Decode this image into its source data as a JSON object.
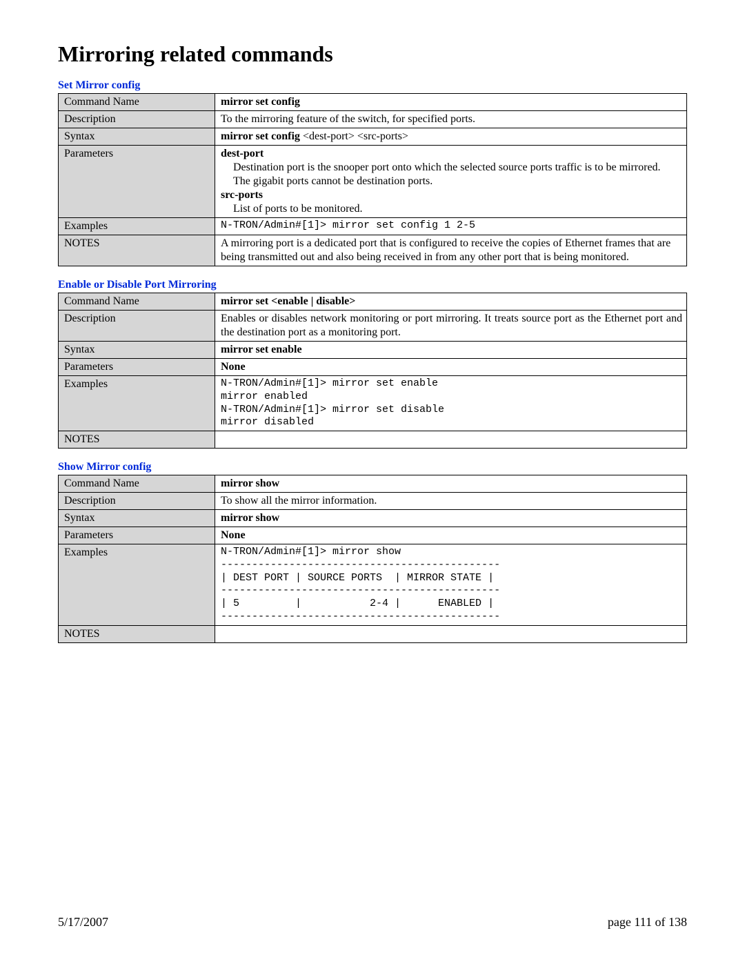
{
  "title": "Mirroring related commands",
  "sections": [
    {
      "heading": "Set Mirror config",
      "rows": {
        "command_name_label": "Command Name",
        "command_name_value": "mirror set config",
        "description_label": "Description",
        "description_value": "To the mirroring feature of the switch, for specified ports.",
        "syntax_label": "Syntax",
        "syntax_bold": "mirror set config",
        "syntax_rest": " <dest-port> <src-ports>",
        "parameters_label": "Parameters",
        "param1_name": "dest-port",
        "param1_desc1": "Destination port is the snooper port onto which the selected source ports traffic is to be mirrored.",
        "param1_desc2": "The gigabit ports cannot be destination ports.",
        "param2_name": "src-ports",
        "param2_desc": "List of ports to be monitored.",
        "examples_label": "Examples",
        "examples_value": "N-TRON/Admin#[1]> mirror set config 1 2-5",
        "notes_label": "NOTES",
        "notes_value": "A mirroring port is a dedicated port that is configured to receive the copies of Ethernet frames that are being transmitted out and also being received in from any other port that is being monitored."
      }
    },
    {
      "heading": "Enable or Disable Port Mirroring",
      "rows": {
        "command_name_label": "Command Name",
        "command_name_value": "mirror set <enable | disable>",
        "description_label": "Description",
        "description_value": "Enables or disables network monitoring or port mirroring. It treats source port as the Ethernet port and the destination port as a monitoring port.",
        "syntax_label": "Syntax",
        "syntax_value": "mirror set enable",
        "parameters_label": "Parameters",
        "parameters_value": "None",
        "examples_label": "Examples",
        "examples_value": "N-TRON/Admin#[1]> mirror set enable\nmirror enabled\nN-TRON/Admin#[1]> mirror set disable\nmirror disabled",
        "notes_label": "NOTES",
        "notes_value": ""
      }
    },
    {
      "heading": "Show Mirror config",
      "rows": {
        "command_name_label": "Command Name",
        "command_name_value": "mirror show",
        "description_label": "Description",
        "description_value": "To show all the mirror information.",
        "syntax_label": "Syntax",
        "syntax_value": "mirror show",
        "parameters_label": "Parameters",
        "parameters_value": "None",
        "examples_label": "Examples",
        "examples_value": "N-TRON/Admin#[1]> mirror show\n---------------------------------------------\n| DEST PORT | SOURCE PORTS  | MIRROR STATE |\n---------------------------------------------\n| 5         |           2-4 |      ENABLED |\n---------------------------------------------",
        "notes_label": "NOTES",
        "notes_value": ""
      }
    }
  ],
  "footer": {
    "date": "5/17/2007",
    "page": "page 111 of 138"
  }
}
